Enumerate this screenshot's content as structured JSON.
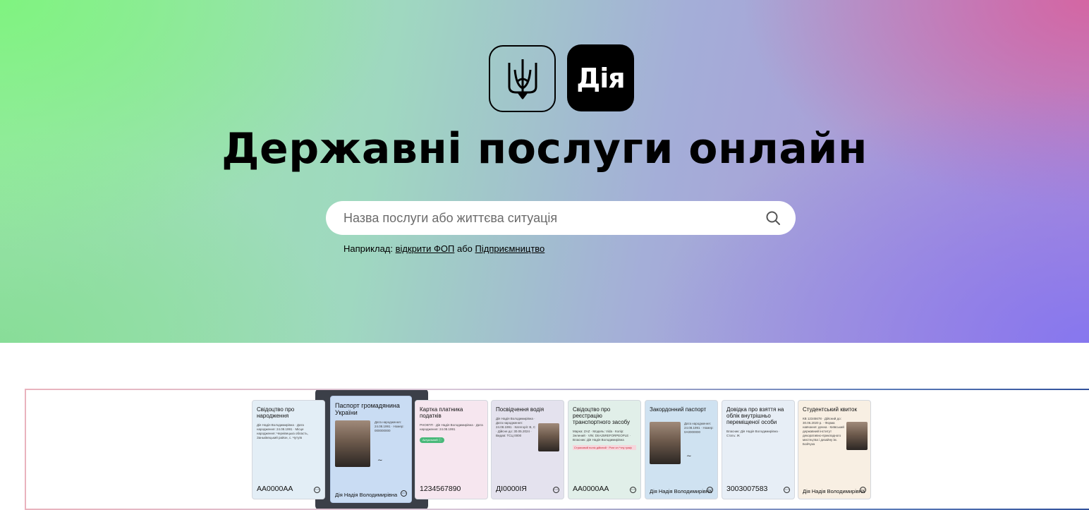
{
  "header": {
    "diia_logo_text": "Дія",
    "title": "Державні послуги онлайн"
  },
  "search": {
    "placeholder": "Назва послуги або життєва ситуація"
  },
  "examples": {
    "prefix": "Наприклад:",
    "link1": "відкрити ФОП",
    "separator": "або",
    "link2": "Підприємництво"
  },
  "documents": [
    {
      "title": "Свідоцтво про народження",
      "small": "Дія Надія Володимирівна · Дата народження: 24.08.1991 · Місце народження: Чернівецька область, Заньківецький район, с. Чутуїв",
      "bottom": "АА0000АА",
      "bg": "#e3eef6"
    },
    {
      "title": "Паспорт громадянина України",
      "small": "Дата народження: 24.08.1991 · Номер: 000000000",
      "bottom": "Дія Надія Володимирівна",
      "bg": "#c9dcf3"
    },
    {
      "title": "Картка платника податків",
      "small": "РНОКПП · Дія Надія Володимирівна · Дата народження: 24.08.1991",
      "badge": "Актуальний ⓘ",
      "bottom": "1234567890",
      "bg": "#f6e6ef"
    },
    {
      "title": "Посвідчення водія",
      "small": "Дія Надія Володимирівна · Дата народження: 24.08.1991 · Категорії: B, C · Дійсне до: 30.05.2024 · Видав: ТСЦ 0000",
      "bottom": "ДІ0000ІЯ",
      "bg": "#e4e2ee"
    },
    {
      "title": "Свідоцтво про реєстрацію транспортного засобу",
      "small": "Марка: ZAZ · Модель: Vida · Колір: Зелений · VIN: DIIA25REFORPEOPLE · Власник: Дія Надія Володимирівна",
      "strip": "Страховий поліс дійсний · Ргат сп *тлу граф",
      "bottom": "АА0000АА",
      "bg": "#e1efe9"
    },
    {
      "title": "Закордонний паспорт",
      "small": "Дата народження: 24.08.1991 · Номер: 0A0000000",
      "bottom": "Дія Надія Володимирівна",
      "bg": "#cfe2f1"
    },
    {
      "title": "Довідка про взяття на облік внутрішньо переміщеної особи",
      "small": "Власник: Дія Надія Володимирівна · Стать: Ж",
      "bottom": "3003007583",
      "bg": "#e7eef6"
    },
    {
      "title": "Студентський квиток",
      "small": "КВ 12345678 · Дійсний до: 30.06.2020 р. · Форма навчання: денна · Київський державний інститут декоративно-прикладного мистецтва і дизайну ім. Бойчука",
      "bottom": "Дія Надія Володимирівна",
      "bg": "#f8efe3"
    }
  ],
  "colors": {
    "hero_green": "#7ef47e",
    "hero_pink": "#d664a0",
    "hero_purple": "#8476f0",
    "logo_black": "#000000"
  },
  "icons": {
    "tryzub": "tryzub-icon",
    "search": "search-icon",
    "more": "more-icon"
  }
}
